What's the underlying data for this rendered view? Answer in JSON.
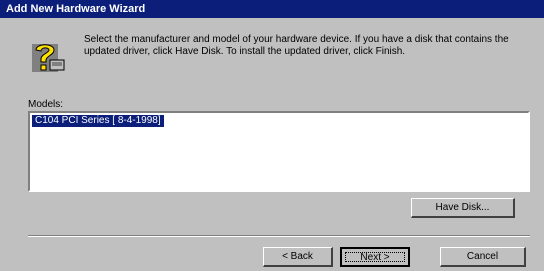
{
  "window": {
    "title": "Add New Hardware Wizard"
  },
  "icon": "question-mark-icon",
  "description": "Select the manufacturer and model of your hardware device. If you have a disk that contains the updated driver, click Have Disk. To install the updated driver, click Finish.",
  "models": {
    "label": "Models:",
    "items": [
      "C104 PCI Series [ 8-4-1998]"
    ]
  },
  "buttons": {
    "have_disk": "Have Disk...",
    "back": "< Back",
    "next": "Next >",
    "cancel": "Cancel"
  },
  "colors": {
    "titlebar": "#0a1e7a",
    "face": "#c0c0c0",
    "selection": "#0a1e7a"
  }
}
